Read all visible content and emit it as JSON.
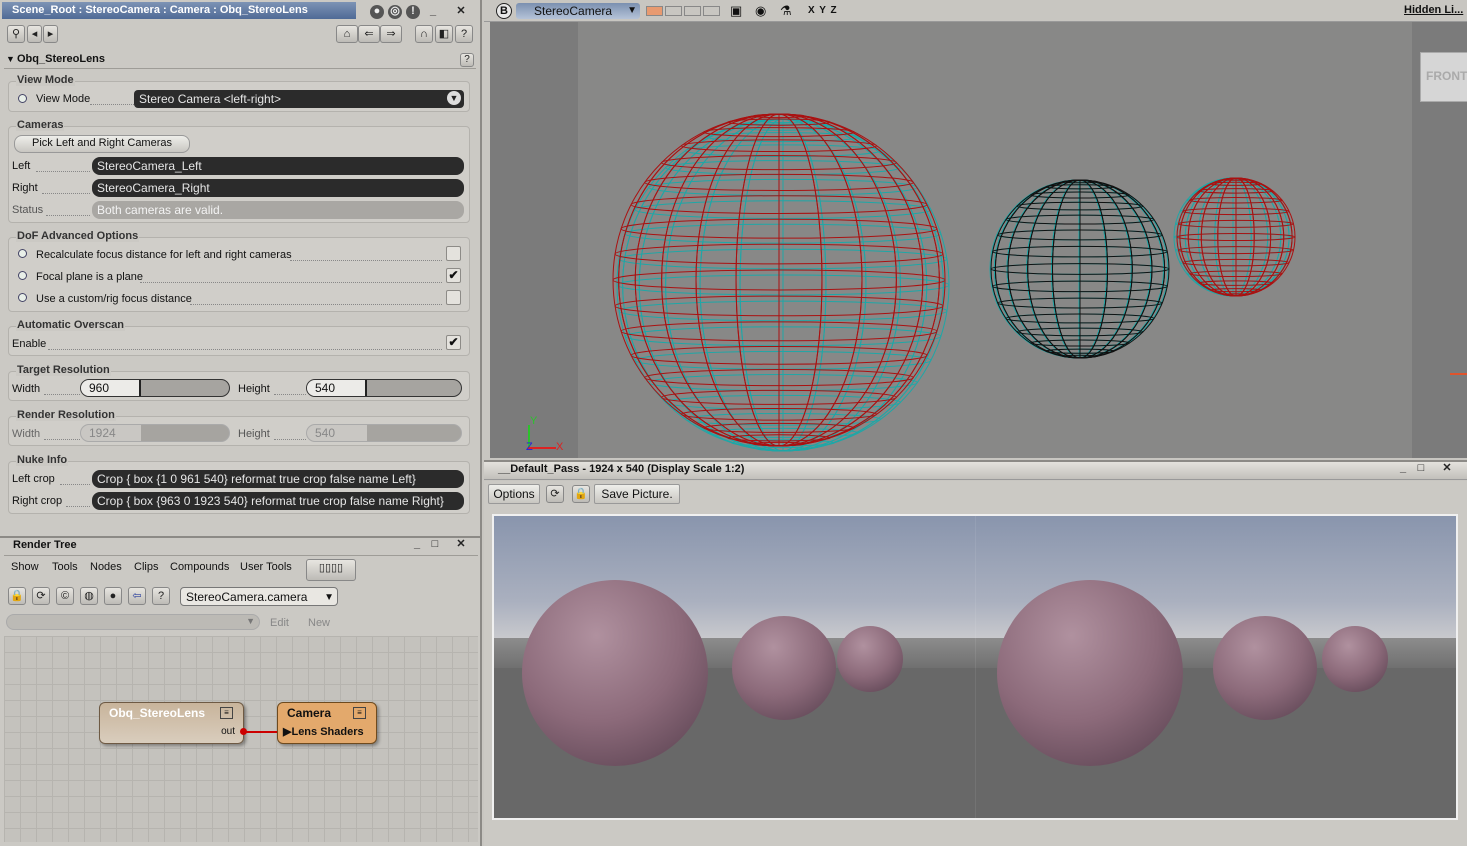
{
  "prop_panel": {
    "title": "Scene_Root : StereoCamera : Camera : Obq_StereoLens",
    "section": "Obq_StereoLens",
    "view_mode": {
      "group": "View Mode",
      "label": "View Mode",
      "value": "Stereo Camera <left-right>"
    },
    "cameras": {
      "group": "Cameras",
      "pick_button": "Pick Left and Right Cameras",
      "left_label": "Left",
      "left_value": "StereoCamera_Left",
      "right_label": "Right",
      "right_value": "StereoCamera_Right",
      "status_label": "Status",
      "status_value": "Both cameras are valid."
    },
    "dof": {
      "group": "DoF Advanced Options",
      "opt1": "Recalculate focus distance for left and right cameras",
      "opt1_checked": false,
      "opt2": "Focal plane is a plane",
      "opt2_checked": true,
      "opt3": "Use a custom/rig focus distance",
      "opt3_checked": false
    },
    "overscan": {
      "group": "Automatic Overscan",
      "enable_label": "Enable",
      "enable_checked": true
    },
    "target_res": {
      "group": "Target Resolution",
      "width_label": "Width",
      "width_value": "960",
      "height_label": "Height",
      "height_value": "540"
    },
    "render_res": {
      "group": "Render Resolution",
      "width_label": "Width",
      "width_value": "1924",
      "height_label": "Height",
      "height_value": "540"
    },
    "nuke": {
      "group": "Nuke Info",
      "left_label": "Left crop",
      "left_value": "Crop { box {1 0 961 540} reformat true crop false name Left}",
      "right_label": "Right crop",
      "right_value": "Crop { box {963 0 1923 540} reformat true crop false name Right}"
    }
  },
  "render_tree": {
    "title": "Render Tree",
    "menus": [
      "Show",
      "Tools",
      "Nodes",
      "Clips",
      "Compounds",
      "User Tools"
    ],
    "camera_select": "StereoCamera.camera",
    "edit_label": "Edit",
    "new_label": "New",
    "node1": {
      "title": "Obq_StereoLens",
      "port": "out"
    },
    "node2": {
      "title": "Camera",
      "port": "Lens Shaders"
    }
  },
  "viewport": {
    "badge": "B",
    "camera": "StereoCamera",
    "axes": "X Y Z",
    "hidden": "Hidden Li...",
    "cube_label": "FRONT",
    "gizmo_x": "X",
    "gizmo_y": "Y",
    "gizmo_z": "Z"
  },
  "render_region": {
    "title": "__Default_Pass -  1924 x 540 (Display Scale 1:2)",
    "options_label": "Options",
    "save_label": "Save Picture."
  }
}
